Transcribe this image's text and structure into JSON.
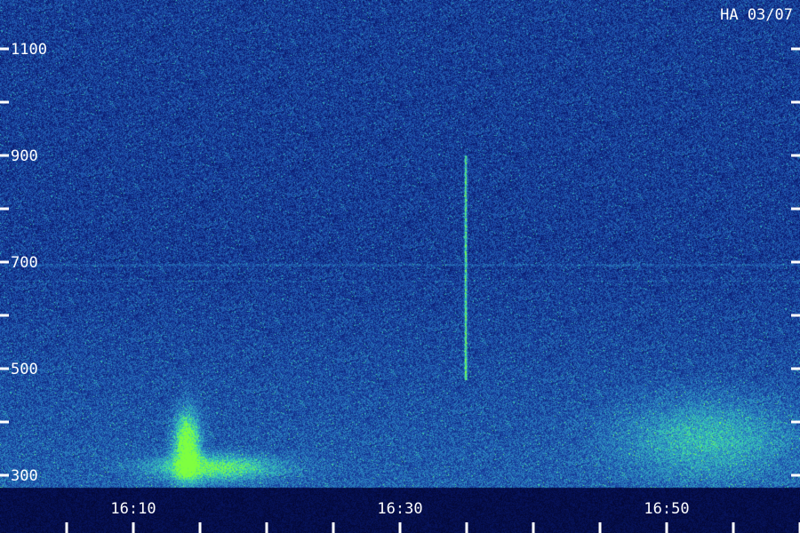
{
  "chart_data": {
    "type": "heatmap",
    "station_label": "HA 03/07",
    "x_tick_labels": [
      "16:10",
      "16:30",
      "16:50"
    ],
    "x_tick_values_min": [
      10,
      30,
      50
    ],
    "x_range_min": [
      10,
      60
    ],
    "x_minor_step_min": 5,
    "y_tick_labels": [
      "300",
      "500",
      "700",
      "900",
      "1100"
    ],
    "y_tick_values": [
      300,
      500,
      700,
      900,
      1100
    ],
    "y_range": [
      290,
      1200
    ],
    "y_minor_step": 100,
    "grid": false,
    "colormap": [
      "#00001e",
      "#0a1a6e",
      "#1c4aa8",
      "#2e8fc4",
      "#3ad6b0",
      "#7fff40"
    ],
    "bright_regions": [
      {
        "t_start": 13,
        "t_end": 15,
        "f_low": 290,
        "f_high": 420,
        "intensity": 0.95
      },
      {
        "t_start": 11,
        "t_end": 21,
        "f_low": 290,
        "f_high": 340,
        "intensity": 0.6
      },
      {
        "t_start": 46,
        "t_end": 60,
        "f_low": 290,
        "f_high": 450,
        "intensity": 0.35
      }
    ],
    "vertical_streaks": [
      {
        "t": 34.9,
        "f_low": 480,
        "f_high": 900,
        "intensity": 0.7
      }
    ]
  }
}
